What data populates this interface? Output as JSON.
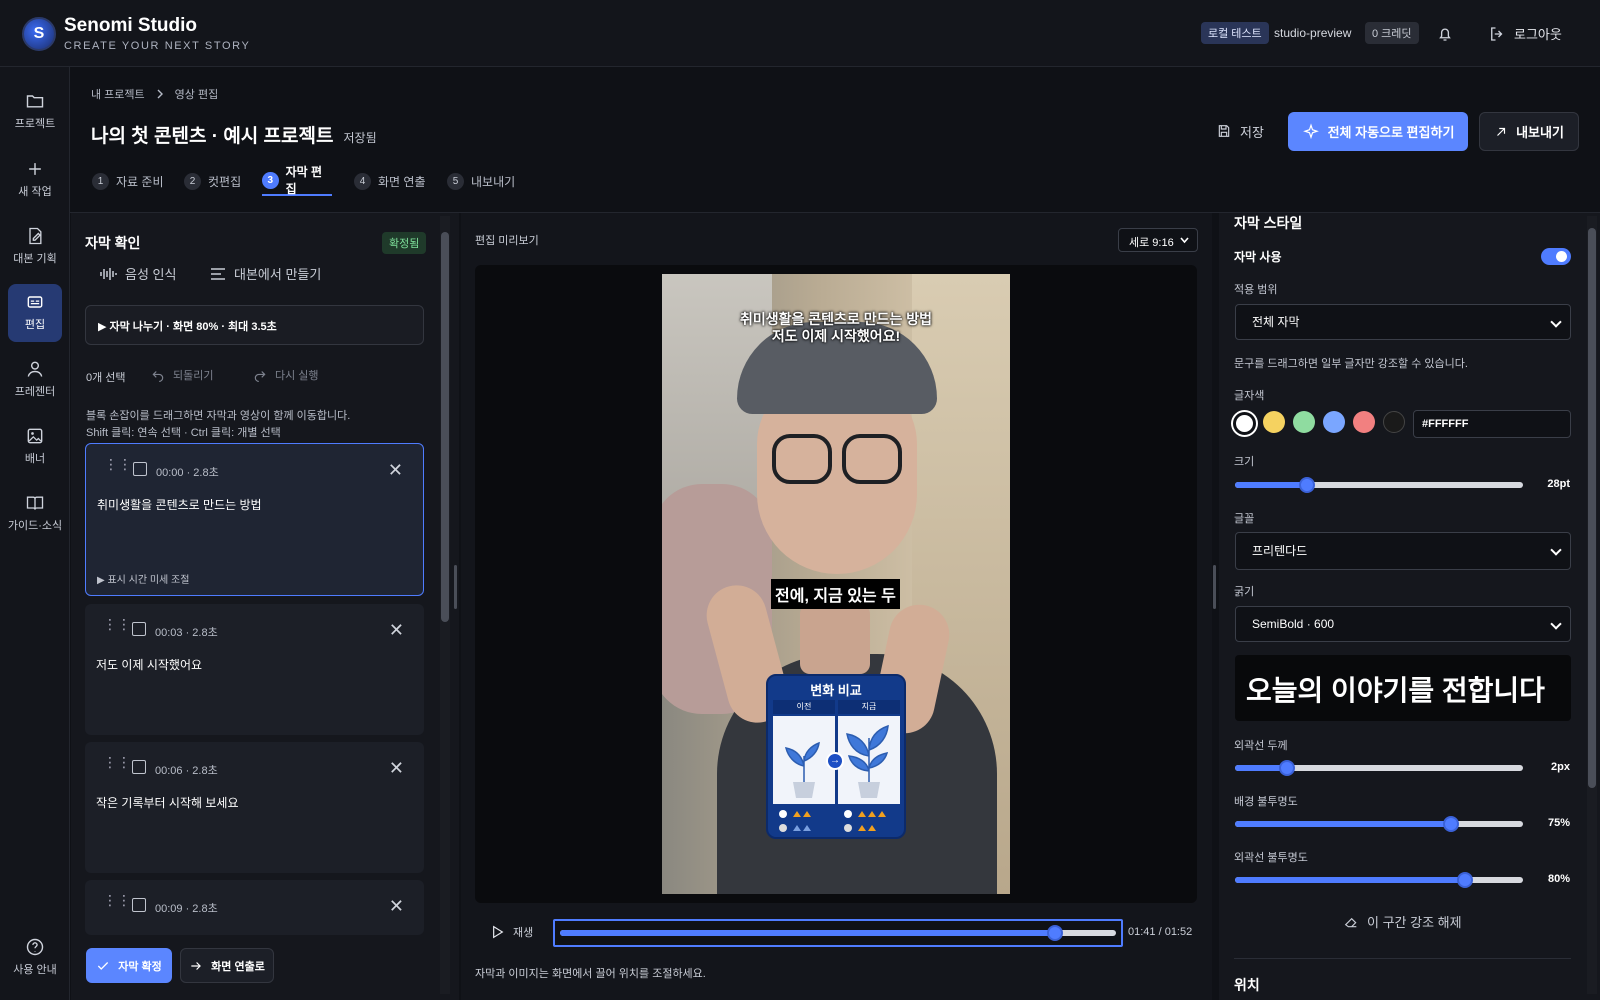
{
  "app": {
    "brand": "Senomi Studio",
    "tagline": "CREATE YOUR NEXT STORY",
    "badge_local": "로컬 테스트",
    "env": "studio-preview",
    "credits": "0 크레딧",
    "logout": "로그아웃"
  },
  "sidebar": {
    "items": [
      {
        "label": "프로젝트"
      },
      {
        "label": "새 작업"
      },
      {
        "label": "대본 기획"
      },
      {
        "label": "편집"
      },
      {
        "label": "프레젠터"
      },
      {
        "label": "배너"
      },
      {
        "label": "가이드·소식"
      }
    ],
    "help": "사용 안내"
  },
  "header": {
    "breadcrumb": [
      "내 프로젝트",
      "영상 편집"
    ],
    "title": "나의 첫 콘텐츠 · 예시 프로젝트",
    "saved": "저장됨",
    "save_label": "저장",
    "auto_edit_label": "전체 자동으로 편집하기",
    "export_label": "내보내기",
    "steps": [
      {
        "num": "1",
        "label": "자료 준비"
      },
      {
        "num": "2",
        "label": "컷편집"
      },
      {
        "num": "3",
        "label": "자막 편집"
      },
      {
        "num": "4",
        "label": "화면 연출"
      },
      {
        "num": "5",
        "label": "내보내기"
      }
    ]
  },
  "left": {
    "title": "자막 확인",
    "confirmed_badge": "확정됨",
    "voice_tab": "음성 인식",
    "script_tab": "대본에서 만들기",
    "split_summary": "▶ 자막 나누기 · 화면 80% · 최대 3.5초",
    "selected_count": "0개 선택",
    "undo": "되돌리기",
    "redo": "다시 실행",
    "help_line1": "블록 손잡이를 드래그하면 자막과 영상이 함께 이동합니다.",
    "help_line2": "Shift 클릭: 연속 선택 · Ctrl 클릭: 개별 선택",
    "fine_tune": "▶ 표시 시간 미세 조절",
    "cards": [
      {
        "time": "00:00 · 2.8초",
        "text": "취미생활을 콘텐츠로 만드는 방법"
      },
      {
        "time": "00:03 · 2.8초",
        "text": "저도 이제 시작했어요"
      },
      {
        "time": "00:06 · 2.8초",
        "text": "작은 기록부터 시작해 보세요"
      },
      {
        "time": "00:09 · 2.8초",
        "text": ""
      }
    ],
    "confirm_label": "자막 확정",
    "next_label": "화면 연출로"
  },
  "preview": {
    "label": "편집 미리보기",
    "ratio": "세로 9:16",
    "subtitle_top_1": "취미생활을 콘텐츠로 만드는 방법",
    "subtitle_top_2": "저도 이제 시작했어요!",
    "subtitle_mid": "전에, 지금 있는 두",
    "card_title": "변화 비교",
    "card_before": "이전",
    "card_after": "지금",
    "play_label": "재생",
    "time": "01:41 / 01:52",
    "progress": 0.89,
    "hint": "자막과 이미지는 화면에서 끌어 위치를 조절하세요."
  },
  "style": {
    "title": "자막 스타일",
    "use_label": "자막 사용",
    "use_on": true,
    "range_label": "적용 범위",
    "range_value": "전체 자막",
    "drag_hint": "문구를 드래그하면 일부 글자만 강조할 수 있습니다.",
    "color_label": "글자색",
    "swatches": [
      "#ffffff",
      "#f5d260",
      "#8fdca0",
      "#7aa6ff",
      "#f28080",
      "#1a1a1a"
    ],
    "color_value": "#FFFFFF",
    "size_label": "크기",
    "size_value": "28pt",
    "size_level": 0.25,
    "font_label": "글꼴",
    "font_value": "프리텐다드",
    "weight_label": "굵기",
    "weight_value": "SemiBold · 600",
    "sample_text": "오늘의 이야기를 전합니다",
    "outline_label": "외곽선 두께",
    "outline_value": "2px",
    "outline_level": 0.18,
    "bg_opacity_label": "배경 불투명도",
    "bg_opacity_value": "75%",
    "bg_opacity_level": 0.75,
    "outline_opacity_label": "외곽선 불투명도",
    "outline_opacity_value": "80%",
    "outline_opacity_level": 0.8,
    "clear_highlight": "이 구간 강조 해제",
    "position_label": "위치"
  }
}
